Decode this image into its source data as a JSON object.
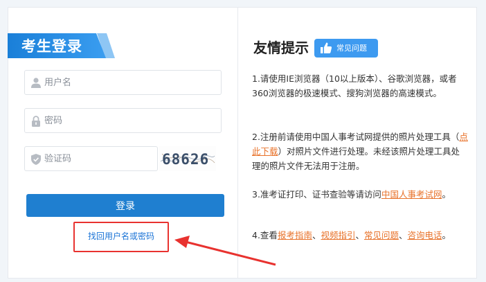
{
  "login": {
    "title": "考生登录",
    "username_placeholder": "用户名",
    "password_placeholder": "密码",
    "captcha_placeholder": "验证码",
    "captcha_text": "68626",
    "login_button": "登录",
    "recover_link": "找回用户名或密码"
  },
  "tips": {
    "title": "友情提示",
    "faq_badge": "常见问题",
    "p1": "1.请使用IE浏览器（10以上版本）、谷歌浏览器，或者360浏览器的极速模式、搜狗浏览器的高速模式。",
    "p2_a": "2.注册前请使用中国人事考试网提供的照片处理工具（",
    "p2_link": "点此下载",
    "p2_b": "）对照片文件进行处理。未经该照片处理工具处理的照片文件无法用于注册。",
    "p3_a": "3.准考证打印、证书查验等请访问",
    "p3_link": "中国人事考试网",
    "p3_b": "。",
    "p4_a": "4.查看",
    "p4_link1": "报考指南",
    "p4_sep1": "、",
    "p4_link2": "视频指引",
    "p4_sep2": "、",
    "p4_link3": "常见问题",
    "p4_sep3": "、",
    "p4_link4": "咨询电话",
    "p4_end": "。"
  },
  "colors": {
    "primary": "#1f7fd0",
    "link": "#1a73d6",
    "orange_link": "#e8722a",
    "annotation_red": "#e8322f"
  },
  "icons": {
    "username": "user-icon",
    "password": "lock-icon",
    "captcha": "shield-icon",
    "faq": "thumbs-up-icon"
  }
}
